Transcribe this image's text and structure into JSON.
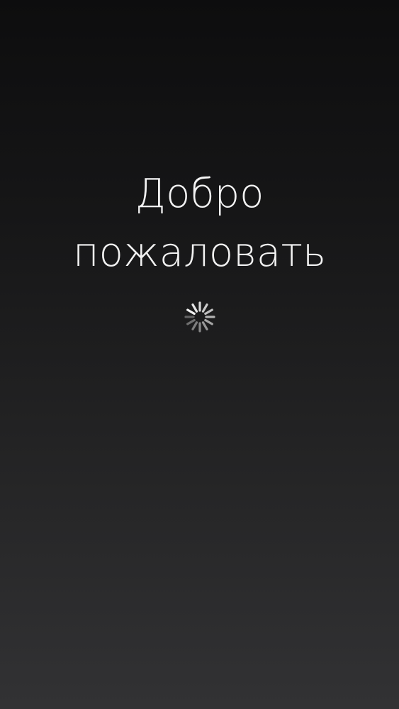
{
  "welcome": {
    "line1": "Добро",
    "line2": "пожаловать"
  },
  "spinner": {
    "icon": "activity-indicator-icon",
    "color": "#ffffff"
  },
  "background": {
    "top_color": "#0d0d0e",
    "bottom_color": "#323234"
  }
}
